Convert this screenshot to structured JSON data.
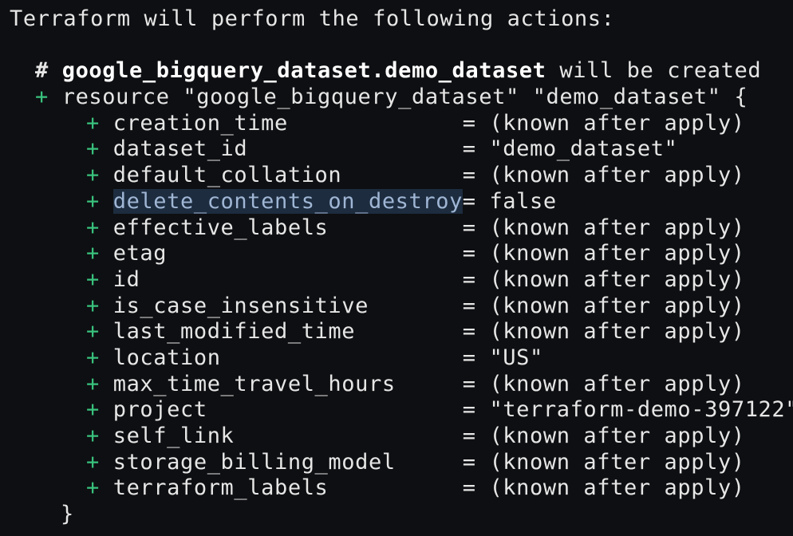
{
  "terminal": {
    "intro": "Terraform will perform the following actions:",
    "comment_hash": "#",
    "comment_resource": "google_bigquery_dataset.demo_dataset",
    "comment_suffix": "will be created",
    "plus_symbol": "+",
    "resource_line": "resource \"google_bigquery_dataset\" \"demo_dataset\" {",
    "attributes": [
      {
        "key": "creation_time",
        "value": "(known after apply)"
      },
      {
        "key": "dataset_id",
        "value": "\"demo_dataset\""
      },
      {
        "key": "default_collation",
        "value": "(known after apply)"
      },
      {
        "key": "delete_contents_on_destroy",
        "value": "false"
      },
      {
        "key": "effective_labels",
        "value": "(known after apply)"
      },
      {
        "key": "etag",
        "value": "(known after apply)"
      },
      {
        "key": "id",
        "value": "(known after apply)"
      },
      {
        "key": "is_case_insensitive",
        "value": "(known after apply)"
      },
      {
        "key": "last_modified_time",
        "value": "(known after apply)"
      },
      {
        "key": "location",
        "value": "\"US\""
      },
      {
        "key": "max_time_travel_hours",
        "value": "(known after apply)"
      },
      {
        "key": "project",
        "value": "\"terraform-demo-397122\""
      },
      {
        "key": "self_link",
        "value": "(known after apply)"
      },
      {
        "key": "storage_billing_model",
        "value": "(known after apply)"
      },
      {
        "key": "terraform_labels",
        "value": "(known after apply)"
      }
    ],
    "equals": "=",
    "closing_brace": "}",
    "colors": {
      "background": "#0e0f12",
      "plus": "#39c27d",
      "text": "#e6e6e6",
      "selection": "#1d2c3f"
    }
  }
}
